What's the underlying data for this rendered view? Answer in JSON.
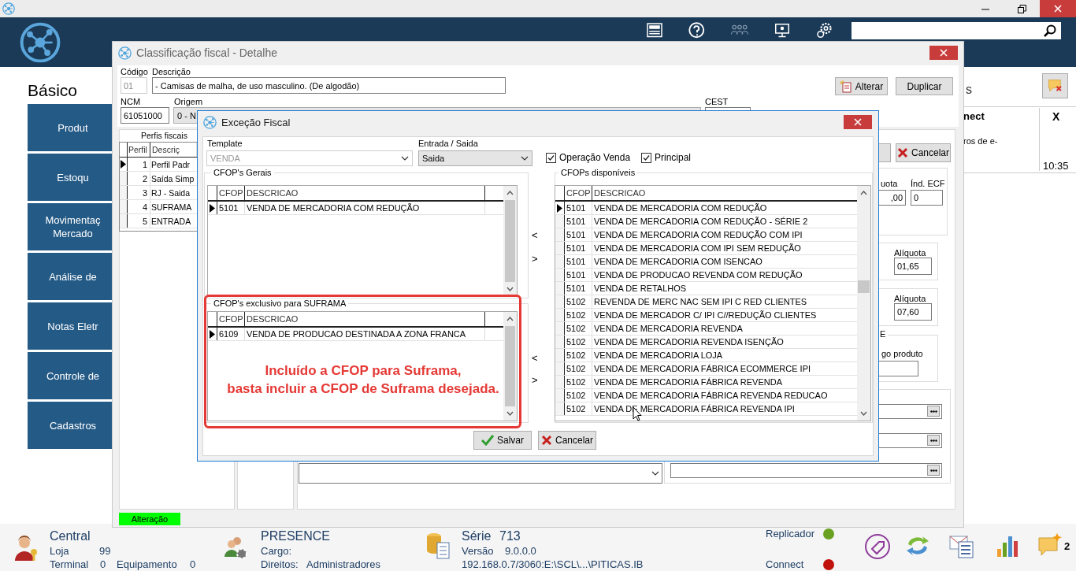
{
  "sidebar": {
    "heading": "Básico",
    "items": [
      {
        "label": "Produt"
      },
      {
        "label": "Estoqu"
      },
      {
        "label": "Movimentaç\nMercado"
      },
      {
        "label": "Análise de"
      },
      {
        "label": "Notas Eletr"
      },
      {
        "label": "Controle de"
      },
      {
        "label": "Cadastros"
      }
    ]
  },
  "notifications": {
    "title": "s",
    "source": "nect",
    "close": "X",
    "text": "ros de e-",
    "time": "10:35"
  },
  "detail_window": {
    "title": "Classificação fiscal - Detalhe",
    "codigo": {
      "label": "Código",
      "value": "01"
    },
    "descricao": {
      "label": "Descrição",
      "value": "- Camisas de malha, de uso masculino. (De algodão)"
    },
    "buttons": [
      "Alterar",
      "Duplicar"
    ],
    "ncm": {
      "label": "NCM",
      "value": "61051000"
    },
    "origem": {
      "label": "Origem",
      "value": "0 - N"
    },
    "cest": {
      "label": "CEST"
    },
    "perfis": {
      "title": "Perfis fiscais",
      "columns": [
        "Perfil",
        "Descriç"
      ],
      "rows": [
        {
          "perfil": "1",
          "descricao": "Perfil Padr",
          "selected": true
        },
        {
          "perfil": "2",
          "descricao": "Saída Simp",
          "selected": false
        },
        {
          "perfil": "3",
          "descricao": "RJ - Saida",
          "selected": false
        },
        {
          "perfil": "4",
          "descricao": "SUFRAMA",
          "selected": false
        },
        {
          "perfil": "5",
          "descricao": "ENTRADA",
          "selected": false
        }
      ]
    },
    "cancel_button": "Cancelar",
    "rate_fields": [
      {
        "label": "uota",
        "value": ",00"
      },
      {
        "label": "Índ. ECF",
        "value": "0"
      }
    ],
    "aliquotas": [
      {
        "label": "Alíquota",
        "value": "01,65"
      },
      {
        "label": "Alíquota",
        "value": "07,60"
      }
    ],
    "group_title": "E",
    "product_label": "go produto",
    "status": "Alteração"
  },
  "exception_dialog": {
    "title": "Exceção Fiscal",
    "template": {
      "label": "Template",
      "value": "VENDA",
      "disabled": true
    },
    "entrada_saida": {
      "label": "Entrada / Saida",
      "value": "Saida"
    },
    "checkboxes": [
      {
        "label": "Operação Venda",
        "checked": true
      },
      {
        "label": "Principal",
        "checked": true
      }
    ],
    "gerais": {
      "title": "CFOP's Gerais",
      "columns": [
        "CFOP",
        "DESCRICAO"
      ],
      "rows": [
        {
          "cfop": "5101",
          "descricao": "VENDA DE MERCADORIA COM REDUÇÃO",
          "selected": true
        }
      ]
    },
    "suframa": {
      "title": "CFOP's exclusivo para SUFRAMA",
      "columns": [
        "CFOP",
        "DESCRICAO"
      ],
      "rows": [
        {
          "cfop": "6109",
          "descricao": "VENDA DE PRODUCAO DESTINADA A ZONA FRANCA",
          "selected": true
        }
      ]
    },
    "move_buttons": [
      "<",
      ">",
      "<",
      ">"
    ],
    "disponiveis": {
      "title": "CFOPs disponíveis",
      "columns": [
        "CFOP",
        "DESCRICAO"
      ],
      "rows": [
        {
          "cfop": "5101",
          "descricao": "VENDA DE MERCADORIA COM REDUÇÃO",
          "selected": true
        },
        {
          "cfop": "5101",
          "descricao": "VENDA DE MERCADORIA COM REDUÇÃO -  SÉRIE 2",
          "selected": false
        },
        {
          "cfop": "5101",
          "descricao": "VENDA DE MERCADORIA COM REDUÇÃO COM IPI",
          "selected": false
        },
        {
          "cfop": "5101",
          "descricao": "VENDA DE MERCADORIA COM IPI SEM REDUÇÃO",
          "selected": false
        },
        {
          "cfop": "5101",
          "descricao": "VENDA DE MERCADORIA COM ISENCAO",
          "selected": false
        },
        {
          "cfop": "5101",
          "descricao": "VENDA DE PRODUCAO REVENDA COM REDUÇÃO",
          "selected": false
        },
        {
          "cfop": "5101",
          "descricao": "VENDA DE RETALHOS",
          "selected": false
        },
        {
          "cfop": "5102",
          "descricao": "REVENDA DE MERC NAC SEM IPI C RED CLIENTES",
          "selected": false
        },
        {
          "cfop": "5102",
          "descricao": "VENDA DE MERCADOR C/ IPI  C//REDUÇÃO CLIENTES",
          "selected": false
        },
        {
          "cfop": "5102",
          "descricao": "VENDA DE MERCADORIA REVENDA",
          "selected": false
        },
        {
          "cfop": "5102",
          "descricao": "VENDA DE MERCADORIA REVENDA  ISENÇÃO",
          "selected": false
        },
        {
          "cfop": "5102",
          "descricao": "VENDA DE MERCADORIA LOJA",
          "selected": false
        },
        {
          "cfop": "5102",
          "descricao": "VENDA DE MERCADORIA FÁBRICA ECOMMERCE IPI",
          "selected": false
        },
        {
          "cfop": "5102",
          "descricao": "VENDA DE MERCADORIA FÁBRICA REVENDA",
          "selected": false
        },
        {
          "cfop": "5102",
          "descricao": "VENDA DE MERCADORIA FÁBRICA REVENDA REDUCAO",
          "selected": false
        },
        {
          "cfop": "5102",
          "descricao": "VENDA DE MERCADORIA FÁBRICA REVENDA IPI",
          "selected": false
        }
      ]
    },
    "buttons": [
      "Salvar",
      "Cancelar"
    ],
    "annotation": "Incluído a CFOP para Suframa,\nbasta incluir a CFOP de Suframa desejada."
  },
  "status_bar": {
    "central": {
      "title": "Central",
      "loja_label": "Loja",
      "loja": "99",
      "terminal_label": "Terminal",
      "terminal": "0",
      "equipamento_label": "Equipamento",
      "equipamento": "0"
    },
    "user": {
      "title": "PRESENCE",
      "cargo_label": "Cargo:",
      "direitos_label": "Direitos:",
      "direitos": "Administradores"
    },
    "system": {
      "serie_label": "Série",
      "serie": "713",
      "versao_label": "Versão",
      "versao": "9.0.0.0",
      "path": "192.168.0.7/3060:E:\\SCL\\...\\PITICAS.IB"
    },
    "services": [
      {
        "label": "Replicador",
        "color": "#6aa121"
      },
      {
        "label": "Connect",
        "color": "#c0120c"
      }
    ],
    "message_count": "2"
  }
}
